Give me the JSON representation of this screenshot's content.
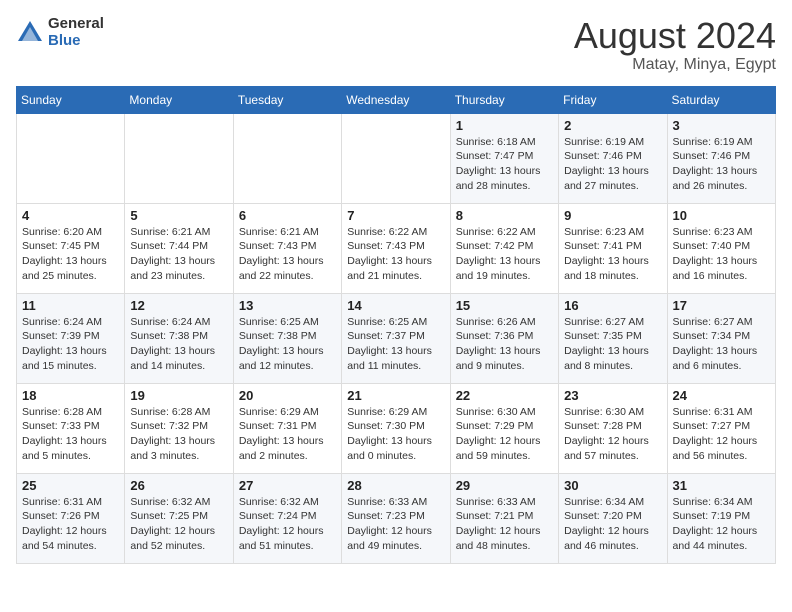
{
  "header": {
    "logo_general": "General",
    "logo_blue": "Blue",
    "month_year": "August 2024",
    "location": "Matay, Minya, Egypt"
  },
  "weekdays": [
    "Sunday",
    "Monday",
    "Tuesday",
    "Wednesday",
    "Thursday",
    "Friday",
    "Saturday"
  ],
  "weeks": [
    [
      {
        "day": "",
        "info": ""
      },
      {
        "day": "",
        "info": ""
      },
      {
        "day": "",
        "info": ""
      },
      {
        "day": "",
        "info": ""
      },
      {
        "day": "1",
        "info": "Sunrise: 6:18 AM\nSunset: 7:47 PM\nDaylight: 13 hours\nand 28 minutes."
      },
      {
        "day": "2",
        "info": "Sunrise: 6:19 AM\nSunset: 7:46 PM\nDaylight: 13 hours\nand 27 minutes."
      },
      {
        "day": "3",
        "info": "Sunrise: 6:19 AM\nSunset: 7:46 PM\nDaylight: 13 hours\nand 26 minutes."
      }
    ],
    [
      {
        "day": "4",
        "info": "Sunrise: 6:20 AM\nSunset: 7:45 PM\nDaylight: 13 hours\nand 25 minutes."
      },
      {
        "day": "5",
        "info": "Sunrise: 6:21 AM\nSunset: 7:44 PM\nDaylight: 13 hours\nand 23 minutes."
      },
      {
        "day": "6",
        "info": "Sunrise: 6:21 AM\nSunset: 7:43 PM\nDaylight: 13 hours\nand 22 minutes."
      },
      {
        "day": "7",
        "info": "Sunrise: 6:22 AM\nSunset: 7:43 PM\nDaylight: 13 hours\nand 21 minutes."
      },
      {
        "day": "8",
        "info": "Sunrise: 6:22 AM\nSunset: 7:42 PM\nDaylight: 13 hours\nand 19 minutes."
      },
      {
        "day": "9",
        "info": "Sunrise: 6:23 AM\nSunset: 7:41 PM\nDaylight: 13 hours\nand 18 minutes."
      },
      {
        "day": "10",
        "info": "Sunrise: 6:23 AM\nSunset: 7:40 PM\nDaylight: 13 hours\nand 16 minutes."
      }
    ],
    [
      {
        "day": "11",
        "info": "Sunrise: 6:24 AM\nSunset: 7:39 PM\nDaylight: 13 hours\nand 15 minutes."
      },
      {
        "day": "12",
        "info": "Sunrise: 6:24 AM\nSunset: 7:38 PM\nDaylight: 13 hours\nand 14 minutes."
      },
      {
        "day": "13",
        "info": "Sunrise: 6:25 AM\nSunset: 7:38 PM\nDaylight: 13 hours\nand 12 minutes."
      },
      {
        "day": "14",
        "info": "Sunrise: 6:25 AM\nSunset: 7:37 PM\nDaylight: 13 hours\nand 11 minutes."
      },
      {
        "day": "15",
        "info": "Sunrise: 6:26 AM\nSunset: 7:36 PM\nDaylight: 13 hours\nand 9 minutes."
      },
      {
        "day": "16",
        "info": "Sunrise: 6:27 AM\nSunset: 7:35 PM\nDaylight: 13 hours\nand 8 minutes."
      },
      {
        "day": "17",
        "info": "Sunrise: 6:27 AM\nSunset: 7:34 PM\nDaylight: 13 hours\nand 6 minutes."
      }
    ],
    [
      {
        "day": "18",
        "info": "Sunrise: 6:28 AM\nSunset: 7:33 PM\nDaylight: 13 hours\nand 5 minutes."
      },
      {
        "day": "19",
        "info": "Sunrise: 6:28 AM\nSunset: 7:32 PM\nDaylight: 13 hours\nand 3 minutes."
      },
      {
        "day": "20",
        "info": "Sunrise: 6:29 AM\nSunset: 7:31 PM\nDaylight: 13 hours\nand 2 minutes."
      },
      {
        "day": "21",
        "info": "Sunrise: 6:29 AM\nSunset: 7:30 PM\nDaylight: 13 hours\nand 0 minutes."
      },
      {
        "day": "22",
        "info": "Sunrise: 6:30 AM\nSunset: 7:29 PM\nDaylight: 12 hours\nand 59 minutes."
      },
      {
        "day": "23",
        "info": "Sunrise: 6:30 AM\nSunset: 7:28 PM\nDaylight: 12 hours\nand 57 minutes."
      },
      {
        "day": "24",
        "info": "Sunrise: 6:31 AM\nSunset: 7:27 PM\nDaylight: 12 hours\nand 56 minutes."
      }
    ],
    [
      {
        "day": "25",
        "info": "Sunrise: 6:31 AM\nSunset: 7:26 PM\nDaylight: 12 hours\nand 54 minutes."
      },
      {
        "day": "26",
        "info": "Sunrise: 6:32 AM\nSunset: 7:25 PM\nDaylight: 12 hours\nand 52 minutes."
      },
      {
        "day": "27",
        "info": "Sunrise: 6:32 AM\nSunset: 7:24 PM\nDaylight: 12 hours\nand 51 minutes."
      },
      {
        "day": "28",
        "info": "Sunrise: 6:33 AM\nSunset: 7:23 PM\nDaylight: 12 hours\nand 49 minutes."
      },
      {
        "day": "29",
        "info": "Sunrise: 6:33 AM\nSunset: 7:21 PM\nDaylight: 12 hours\nand 48 minutes."
      },
      {
        "day": "30",
        "info": "Sunrise: 6:34 AM\nSunset: 7:20 PM\nDaylight: 12 hours\nand 46 minutes."
      },
      {
        "day": "31",
        "info": "Sunrise: 6:34 AM\nSunset: 7:19 PM\nDaylight: 12 hours\nand 44 minutes."
      }
    ]
  ]
}
